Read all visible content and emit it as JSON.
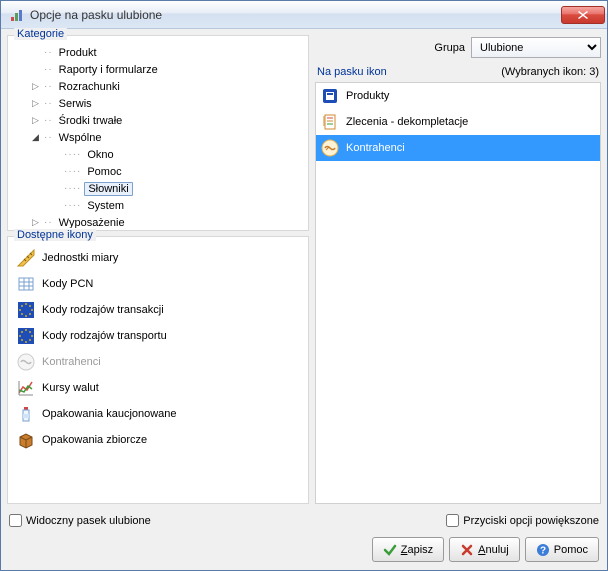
{
  "window": {
    "title": "Opcje na pasku ulubione"
  },
  "labels": {
    "categories": "Kategorie",
    "available": "Dostępne ikony",
    "group": "Grupa",
    "on_bar": "Na pasku ikon",
    "selected_count_prefix": "(Wybranych ikon: ",
    "selected_count": "3",
    "selected_count_suffix": ")",
    "visible_bar": "Widoczny pasek ulubione",
    "enlarged_opts": "Przyciski opcji powiększone"
  },
  "group_select": {
    "value": "Ulubione"
  },
  "tree": {
    "items": [
      {
        "label": "Produkt",
        "level": 1,
        "expander": "none"
      },
      {
        "label": "Raporty i formularze",
        "level": 1,
        "expander": "none"
      },
      {
        "label": "Rozrachunki",
        "level": 1,
        "expander": "closed"
      },
      {
        "label": "Serwis",
        "level": 1,
        "expander": "closed"
      },
      {
        "label": "Środki trwałe",
        "level": 1,
        "expander": "closed"
      },
      {
        "label": "Wspólne",
        "level": 1,
        "expander": "open"
      },
      {
        "label": "Okno",
        "level": 2,
        "expander": "none"
      },
      {
        "label": "Pomoc",
        "level": 2,
        "expander": "none"
      },
      {
        "label": "Słowniki",
        "level": 2,
        "expander": "none",
        "selected": true
      },
      {
        "label": "System",
        "level": 2,
        "expander": "none"
      },
      {
        "label": "Wyposażenie",
        "level": 1,
        "expander": "closed"
      }
    ]
  },
  "available": {
    "items": [
      {
        "label": "Jednostki miary",
        "icon": "ruler"
      },
      {
        "label": "Kody PCN",
        "icon": "grid"
      },
      {
        "label": "Kody rodzajów transakcji",
        "icon": "eu"
      },
      {
        "label": "Kody rodzajów transportu",
        "icon": "eu"
      },
      {
        "label": "Kontrahenci",
        "icon": "hands-small",
        "disabled": true
      },
      {
        "label": "Kursy walut",
        "icon": "chart"
      },
      {
        "label": "Opakowania kaucjonowane",
        "icon": "bottle"
      },
      {
        "label": "Opakowania zbiorcze",
        "icon": "box"
      }
    ]
  },
  "on_bar": {
    "items": [
      {
        "label": "Produkty",
        "icon": "product"
      },
      {
        "label": "Zlecenia - dekompletacje",
        "icon": "orders"
      },
      {
        "label": "Kontrahenci",
        "icon": "hands",
        "selected": true
      }
    ]
  },
  "buttons": {
    "save": "Zapisz",
    "cancel": "Anuluj",
    "help": "Pomoc"
  }
}
